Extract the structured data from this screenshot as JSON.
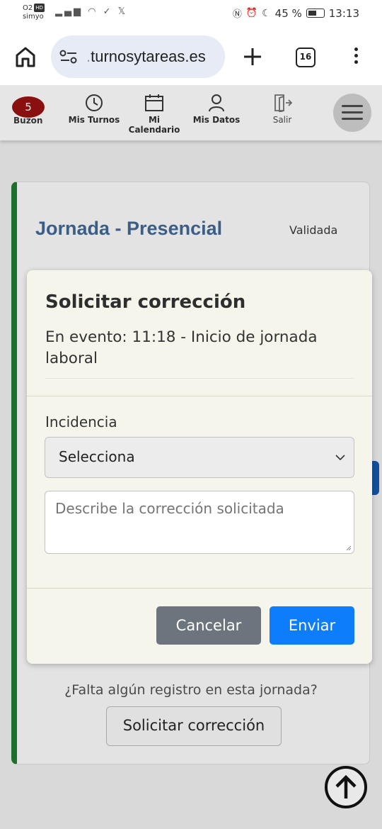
{
  "status_bar": {
    "carrier_line1": "O2",
    "hd_badge": "HD",
    "carrier_line2": "simyo",
    "left_icons": "signal-icon wifi-icon check-icon x-icon",
    "battery_text": "45 %",
    "battery_level": 0.45,
    "time": "13:13"
  },
  "browser": {
    "url_prefix": ".",
    "url": "turnosytareas.es",
    "tab_count": "16"
  },
  "nav": {
    "badge_count": "5",
    "buzon": "Buzon",
    "mis_turnos": "Mis Turnos",
    "mi_calendario": "Mi Calendario",
    "mis_datos": "Mis Datos",
    "salir": "Salir"
  },
  "card": {
    "title": "Jornada - Presencial",
    "status": "Validada",
    "missing_question": "¿Falta algún registro en esta jornada?",
    "missing_button": "Solicitar corrección"
  },
  "modal": {
    "title": "Solicitar corrección",
    "subtitle": "En evento: 11:18 - Inicio de jornada laboral",
    "field_label": "Incidencia",
    "select_value": "Selecciona",
    "textarea_placeholder": "Describe la corrección solicitada",
    "cancel": "Cancelar",
    "send": "Enviar"
  },
  "colors": {
    "accent_green": "#1c6f2d",
    "title_blue": "#3b5e87",
    "send_blue": "#0d7dfc",
    "cancel_gray": "#6c757d",
    "badge_red": "#8a1010"
  }
}
